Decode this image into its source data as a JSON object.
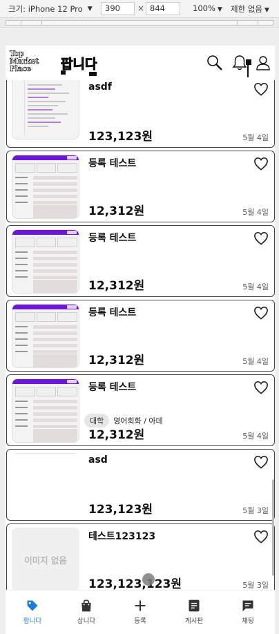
{
  "devtools": {
    "device_label": "크기: iPhone 12 Pro",
    "width_value": "390",
    "height_value": "844",
    "times": "×",
    "zoom_label": "100%",
    "throttle_label": "제한 없음"
  },
  "header": {
    "logo_lines": [
      "Top",
      "Market",
      "Place"
    ],
    "brand": "팝니다"
  },
  "cards": [
    {
      "title": "asdf",
      "price": "123,123원",
      "date": "5월 4일",
      "thumb": "screenshot"
    },
    {
      "title": "등록 테스트",
      "price": "12,312원",
      "date": "5월 4일",
      "thumb": "mockup"
    },
    {
      "title": "등록 테스트",
      "price": "12,312원",
      "date": "5월 4일",
      "thumb": "mockup"
    },
    {
      "title": "등록 테스트",
      "price": "12,312원",
      "date": "5월 4일",
      "thumb": "mockup"
    },
    {
      "title": "등록 테스트",
      "price": "12,312원",
      "date": "5월 4일",
      "thumb": "mockup",
      "tag": "대학",
      "tag_text": "영어회화 / 아데"
    },
    {
      "title": "asd",
      "price": "123,123원",
      "date": "5월 3일",
      "thumb": "blank"
    },
    {
      "title": "테스트123123",
      "price": "123,123,123원",
      "date": "5월 3일",
      "thumb": "none",
      "no_image_label": "이미지 없음"
    }
  ],
  "bottom_nav": [
    {
      "label": "팝니다",
      "icon": "tag-icon",
      "active": true
    },
    {
      "label": "삽니다",
      "icon": "shopping-bag-icon",
      "active": false
    },
    {
      "label": "등록",
      "icon": "plus-icon",
      "active": false
    },
    {
      "label": "게시판",
      "icon": "board-icon",
      "active": false
    },
    {
      "label": "채팅",
      "icon": "chat-icon",
      "active": false
    }
  ],
  "colors": {
    "accent": "#1f7ae0",
    "mockup_header": "#6b16d8"
  }
}
